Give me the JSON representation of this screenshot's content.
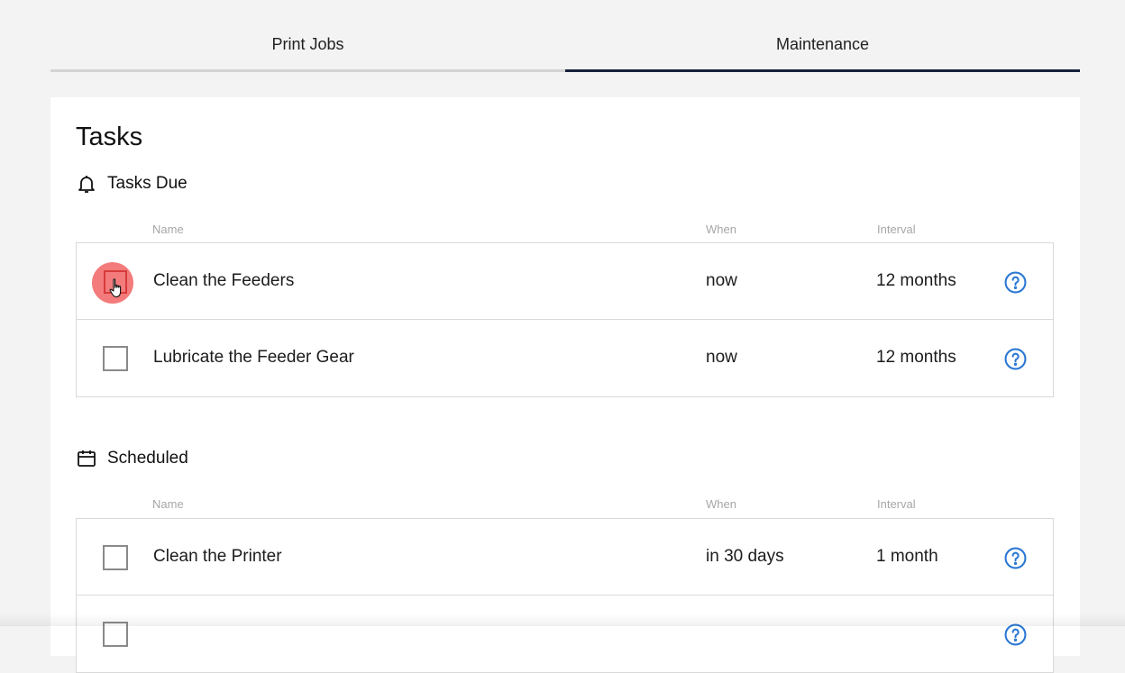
{
  "tabs": [
    {
      "label": "Print Jobs",
      "active": false
    },
    {
      "label": "Maintenance",
      "active": true
    }
  ],
  "page_title": "Tasks",
  "sections": {
    "due": {
      "title": "Tasks Due",
      "icon": "bell-icon",
      "columns": {
        "name": "Name",
        "when": "When",
        "interval": "Interval"
      },
      "rows": [
        {
          "name": "Clean the Feeders",
          "when": "now",
          "interval": "12 months",
          "checked": false
        },
        {
          "name": "Lubricate the Feeder Gear",
          "when": "now",
          "interval": "12 months",
          "checked": false
        }
      ]
    },
    "scheduled": {
      "title": "Scheduled",
      "icon": "calendar-icon",
      "columns": {
        "name": "Name",
        "when": "When",
        "interval": "Interval"
      },
      "rows": [
        {
          "name": "Clean the Printer",
          "when": "in 30 days",
          "interval": "1 month",
          "checked": false
        },
        {
          "name": "",
          "when": "",
          "interval": "",
          "checked": false
        }
      ]
    }
  },
  "colors": {
    "accent": "#16213a",
    "help": "#2b78d4",
    "click_highlight": "#f05a5a"
  }
}
